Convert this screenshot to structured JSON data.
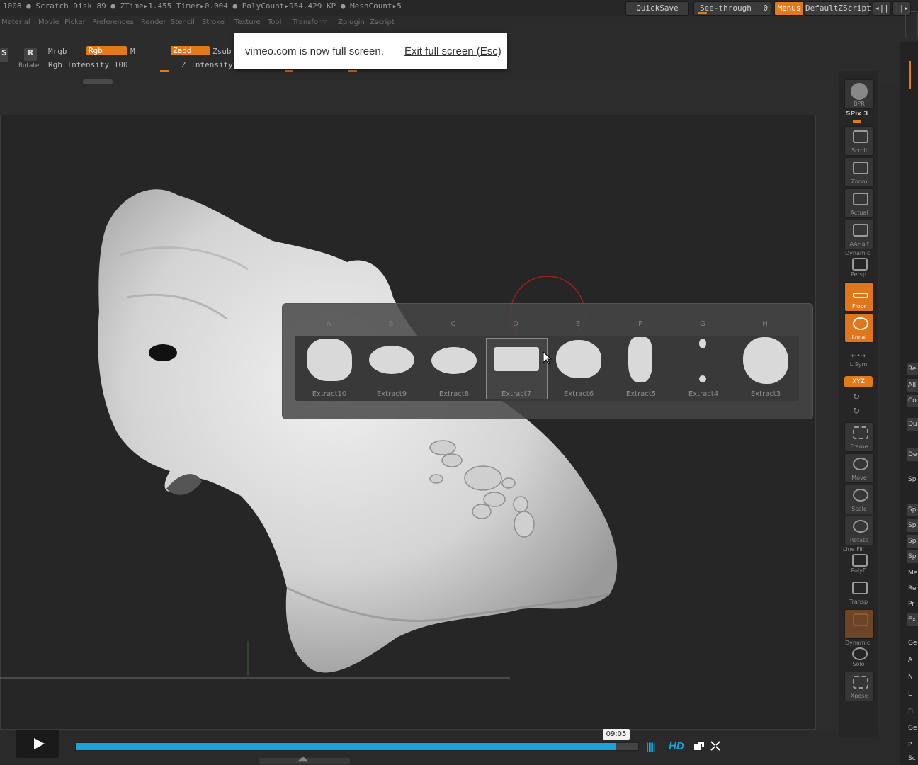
{
  "status": {
    "text": "1008 ● Scratch Disk 89 ●  ZTime▸1.455 Timer▸0.004 ● PolyCount▸954.429 KP  ● MeshCount▸5",
    "quicksave": "QuickSave",
    "see_through": "See-through",
    "see_through_value": "0",
    "menus": "Menus",
    "default_zscript": "DefaultZScript"
  },
  "menus": [
    "Material",
    "Movie",
    "Picker",
    "Preferences",
    "Render",
    "Stencil",
    "Stroke",
    "Texture",
    "Tool",
    "Transform",
    "Zplugin",
    "Zscript"
  ],
  "toolshelf": {
    "rotate": "Rotate",
    "rotate_key": "R",
    "s_key": "S",
    "mrgb": "Mrgb",
    "rgb": "Rgb",
    "m": "M",
    "zadd": "Zadd",
    "zsub": "Zsub",
    "rgb_intensity": "Rgb Intensity 100",
    "z_intensity": "Z Intensity 1"
  },
  "fullscreen_notice": {
    "message": "vimeo.com is now full screen.",
    "exit": "Exit full screen (Esc)"
  },
  "right_shelf": {
    "bpr": "BPR",
    "spix": "SPix 3",
    "scroll": "Scroll",
    "zoom": "Zoom",
    "actual": "Actual",
    "aahalf": "AAHalf",
    "dynamic": "Dynamic",
    "persp": "Persp",
    "floor": "Floor",
    "local": "Local",
    "lsym": "L.Sym",
    "xyz": "XYZ",
    "frame": "Frame",
    "move": "Move",
    "scale": "Scale",
    "rotate": "Rotate",
    "line_fill": "Line Fill",
    "polyf": "PolyF",
    "transp": "Transp",
    "dynamic2": "Dynamic",
    "solo": "Solo",
    "xpose": "Xpose"
  },
  "right_panel": [
    "Re",
    "All",
    "Co",
    "Du",
    "De",
    "Sp",
    "Sp",
    "Sp",
    "Sp",
    "Sp",
    "Me",
    "Re",
    "Pr",
    "Ex",
    "Ge",
    "A",
    "N",
    "L",
    "Fi",
    "Ge",
    "P",
    "Sc"
  ],
  "subtool_popup": {
    "columns": [
      "A",
      "B",
      "C",
      "D",
      "E",
      "F",
      "G",
      "H"
    ],
    "items": [
      "Extract10",
      "Extract9",
      "Extract8",
      "Extract7",
      "Extract6",
      "Extract5",
      "Extract4",
      "Extract3"
    ],
    "selected_index": 3
  },
  "player": {
    "time": "09:05",
    "progress": 0.96,
    "hd": "HD",
    "accent": "#1aa3d8"
  },
  "colors": {
    "zbrush_orange": "#e07a1a",
    "background": "#2a2a2a"
  }
}
